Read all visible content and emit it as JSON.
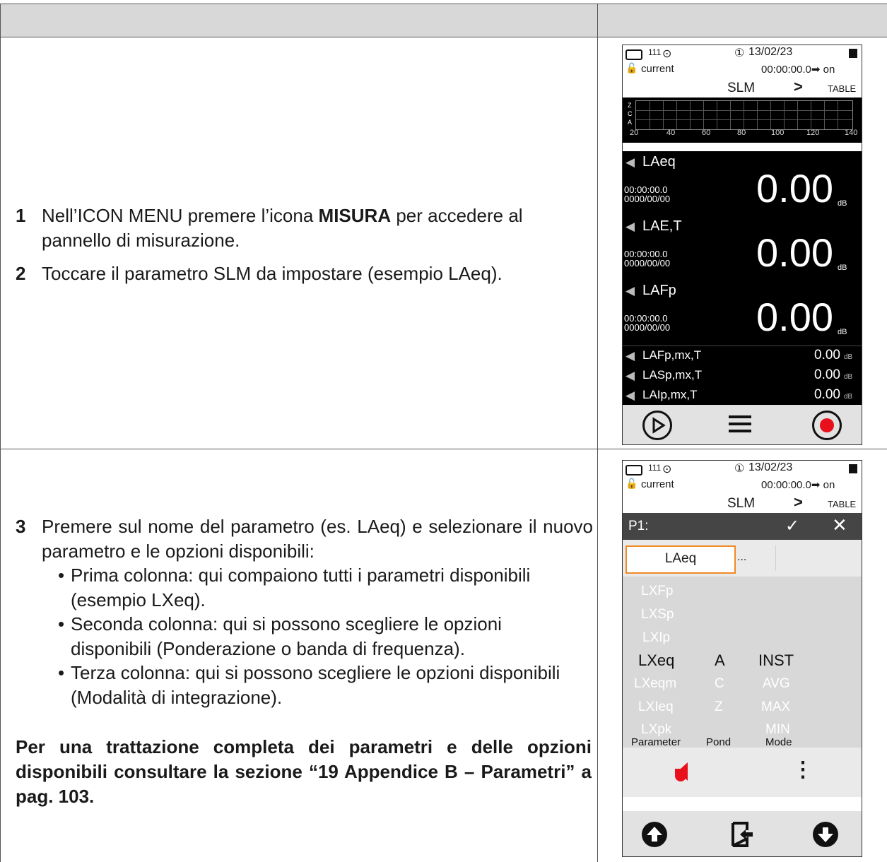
{
  "steps": [
    {
      "num": "1",
      "text_pre": "Nell’ICON MENU premere l’icona ",
      "text_bold": "MISURA",
      "text_post": " per accedere al pannello di misurazione."
    },
    {
      "num": "2",
      "text": "Toccare il parametro SLM da impostare (esempio LAeq)."
    },
    {
      "num": "3",
      "text": "Premere sul nome del parametro (es. LAeq) e selezionare il nuovo parametro e le opzioni disponibili:"
    }
  ],
  "bullets": [
    "Prima colonna: qui compaiono tutti i parametri disponibili (esempio LXeq).",
    "Seconda colonna: qui si possono scegliere le opzioni disponibili (Ponderazione o banda di frequenza).",
    "Terza colonna: qui si possono scegliere le opzioni disponibili (Modalità di integrazione)."
  ],
  "note": "Per una trattazione completa dei parametri e delle opzioni disponibili consultare la sezione “19 Appendice B – Parametri” a pag. 103.",
  "screen": {
    "battery_num": "111",
    "date": "13/02/23",
    "mode_label": "current",
    "time": "00:00:00.0➡ on",
    "title": "SLM",
    "view": "TABLE",
    "meter_letters": [
      "Z",
      "C",
      "A"
    ],
    "scale": [
      "20",
      "40",
      "60",
      "80",
      "100",
      "120",
      "140"
    ],
    "big_params": [
      {
        "name": "LAeq",
        "t": "00:00:00.0",
        "d": "0000/00/00",
        "value": "0.00",
        "unit": "dB"
      },
      {
        "name": "LAE,T",
        "t": "00:00:00.0",
        "d": "0000/00/00",
        "value": "0.00",
        "unit": "dB"
      },
      {
        "name": "LAFp",
        "t": "00:00:00.0",
        "d": "0000/00/00",
        "value": "0.00",
        "unit": "dB"
      }
    ],
    "small_params": [
      {
        "name": "LAFp,mx,T",
        "value": "0.00",
        "unit": "dB"
      },
      {
        "name": "LASp,mx,T",
        "value": "0.00",
        "unit": "dB"
      },
      {
        "name": "LAIp,mx,T",
        "value": "0.00",
        "unit": "dB"
      }
    ]
  },
  "editor": {
    "label": "P1:",
    "check": "✓",
    "close": "✕",
    "field_value": "LAeq",
    "field_more": "...",
    "col1": [
      "LXFp",
      "LXSp",
      "LXIp",
      "LXeq",
      "LXeqm",
      "LXIeq",
      "LXpk"
    ],
    "col2": [
      "A",
      "C",
      "Z"
    ],
    "col3": [
      "INST",
      "AVG",
      "MAX",
      "MIN"
    ],
    "col_headers": [
      "Parameter",
      "Pond",
      "Mode"
    ],
    "menu_dots": "⋮"
  },
  "colors": {
    "header_bg": "#d8d8d8",
    "accent_orange": "#f08a25",
    "record_red": "#e8101a"
  }
}
